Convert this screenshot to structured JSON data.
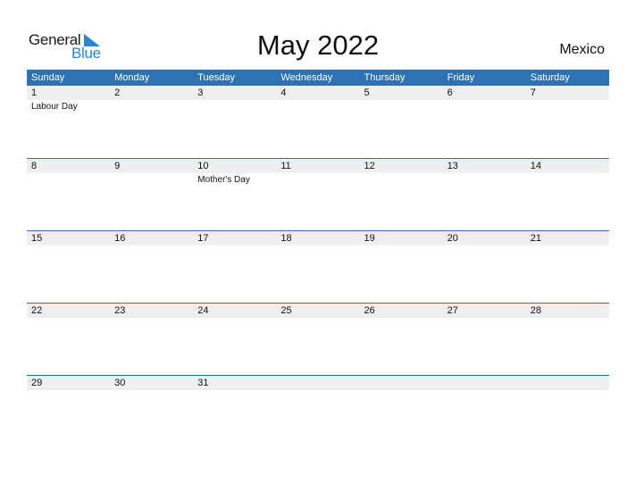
{
  "logo": {
    "word1": "General",
    "word2": "Blue"
  },
  "header": {
    "title": "May 2022",
    "country": "Mexico"
  },
  "days": [
    "Sunday",
    "Monday",
    "Tuesday",
    "Wednesday",
    "Thursday",
    "Friday",
    "Saturday"
  ],
  "weeks": [
    {
      "dates": [
        "1",
        "2",
        "3",
        "4",
        "5",
        "6",
        "7"
      ],
      "holidays": [
        "Labour Day",
        "",
        "",
        "",
        "",
        "",
        ""
      ]
    },
    {
      "dates": [
        "8",
        "9",
        "10",
        "11",
        "12",
        "13",
        "14"
      ],
      "holidays": [
        "",
        "",
        "Mother's Day",
        "",
        "",
        "",
        ""
      ]
    },
    {
      "dates": [
        "15",
        "16",
        "17",
        "18",
        "19",
        "20",
        "21"
      ],
      "holidays": [
        "",
        "",
        "",
        "",
        "",
        "",
        ""
      ]
    },
    {
      "dates": [
        "22",
        "23",
        "24",
        "25",
        "26",
        "27",
        "28"
      ],
      "holidays": [
        "",
        "",
        "",
        "",
        "",
        "",
        ""
      ]
    },
    {
      "dates": [
        "29",
        "30",
        "31",
        "",
        "",
        "",
        ""
      ],
      "holidays": [
        "",
        "",
        "",
        "",
        "",
        "",
        ""
      ]
    }
  ],
  "colors": {
    "accent": "#2e72b4",
    "logo_blue": "#2a86d0",
    "date_row": "#efefef"
  }
}
